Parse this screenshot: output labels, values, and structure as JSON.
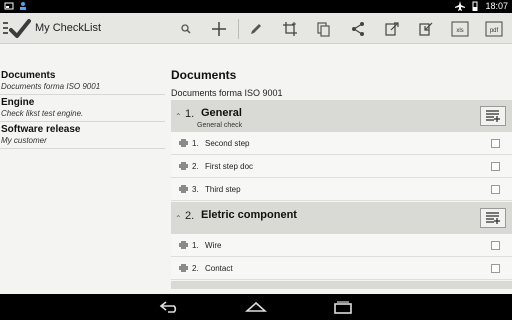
{
  "statusbar": {
    "time": "18:07"
  },
  "actionbar": {
    "title": "My CheckList",
    "icons": [
      "search-icon",
      "add-icon",
      "edit-icon",
      "crop-add-icon",
      "copy-icon",
      "share-icon",
      "export-icon",
      "import-icon",
      "xls-icon",
      "pdf-icon"
    ]
  },
  "left": {
    "items": [
      {
        "title": "Documents",
        "subtitle": "Documents forma ISO 9001"
      },
      {
        "title": "Engine",
        "subtitle": "Check likst test engine."
      },
      {
        "title": "Software release",
        "subtitle": "My customer"
      }
    ]
  },
  "right": {
    "title": "Documents",
    "subtitle": "Documents forma ISO 9001",
    "sections": [
      {
        "num": "1.",
        "name": "General",
        "desc": "General check",
        "items": [
          {
            "num": "1.",
            "label": "Second  step"
          },
          {
            "num": "2.",
            "label": "First step doc"
          },
          {
            "num": "3.",
            "label": "Third step"
          }
        ]
      },
      {
        "num": "2.",
        "name": "Eletric component",
        "desc": "",
        "items": [
          {
            "num": "1.",
            "label": "Wire"
          },
          {
            "num": "2.",
            "label": "Contact"
          }
        ]
      }
    ]
  }
}
